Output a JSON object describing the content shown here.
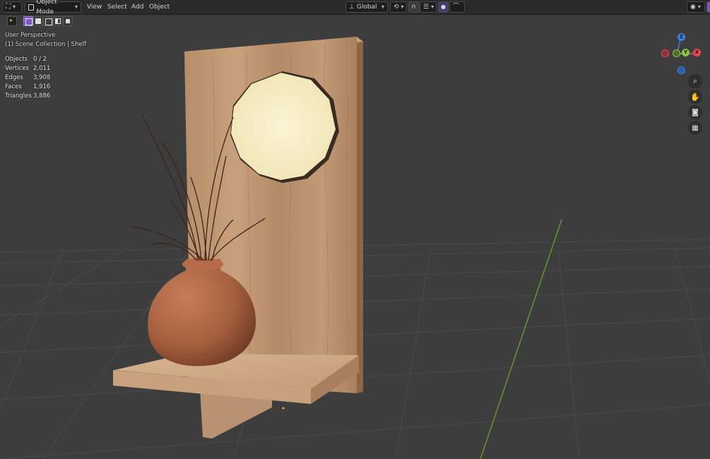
{
  "header": {
    "editor_icon": "globe-editor-type-icon",
    "mode_label": "Object Mode",
    "menus": [
      "View",
      "Select",
      "Add",
      "Object"
    ],
    "transform_label": "Global"
  },
  "viewport": {
    "view_name": "User Perspective",
    "collection": "(1) Scene Collection | Shelf",
    "stats": [
      {
        "label": "Objects",
        "value": "0 / 2"
      },
      {
        "label": "Vertices",
        "value": "2,011"
      },
      {
        "label": "Edges",
        "value": "3,908"
      },
      {
        "label": "Faces",
        "value": "1,916"
      },
      {
        "label": "Triangles",
        "value": "3,886"
      }
    ],
    "gizmo": {
      "z": "Z",
      "y": "Y",
      "x": "X"
    },
    "nav_buttons": [
      "zoom-icon",
      "hand-pan-icon",
      "camera-icon",
      "grid-icon"
    ]
  },
  "colors": {
    "header_bg": "#2b2b2b",
    "viewport_bg": "#3d3d3d",
    "accent_purple": "#7a55c8",
    "x_axis": "#e84a55",
    "y_axis": "#8bc34a",
    "z_axis": "#3a82e0"
  }
}
